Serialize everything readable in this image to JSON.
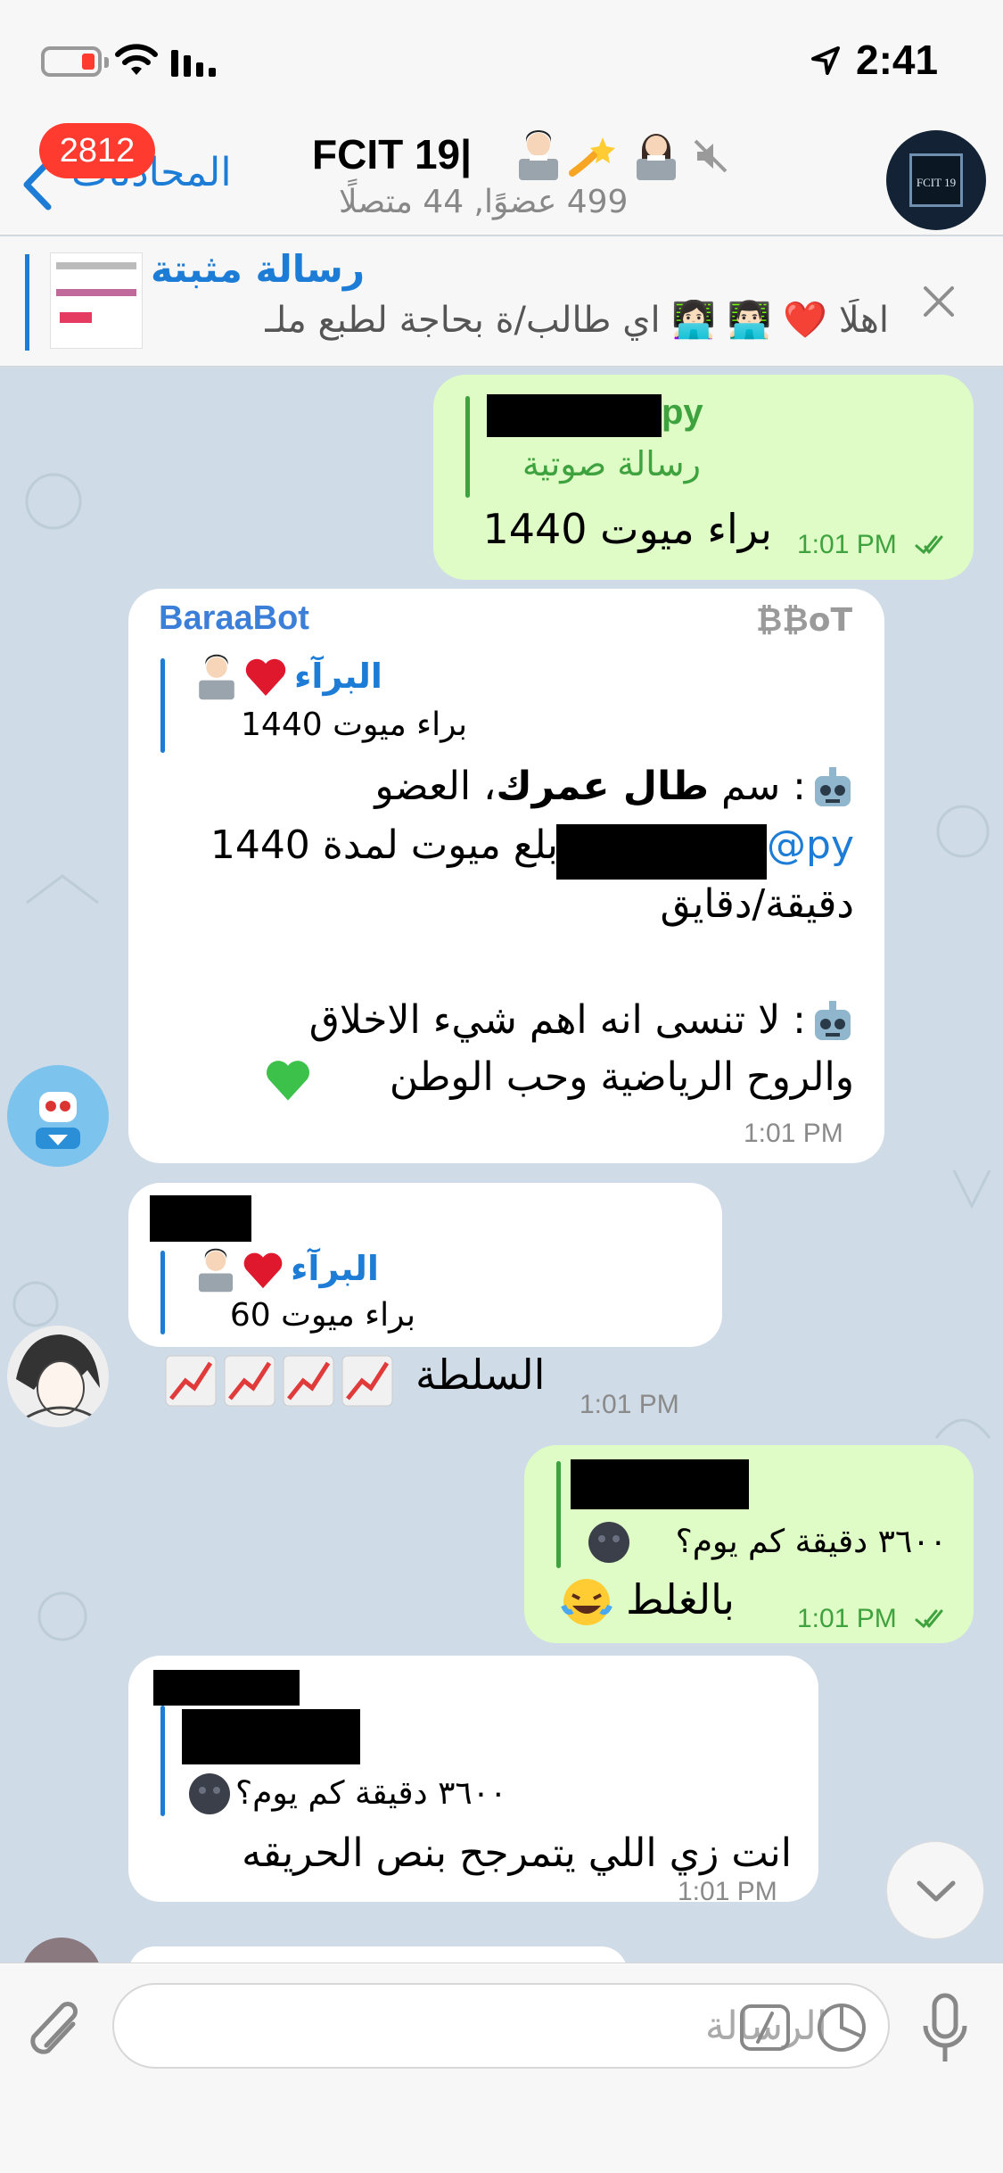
{
  "status_bar": {
    "time": "2:41"
  },
  "header": {
    "back_label": "المحادثات",
    "unread_badge": "2812",
    "title": "FCIT 19|",
    "subtitle": "499 عضوًا, 44 متصلًا"
  },
  "group_avatar": {
    "label": "FCIT 19"
  },
  "pinned": {
    "title": "رسالة مثبتة",
    "text": "اهلًا ❤️ 👨🏻‍💻 👩🏻‍💻 اي طالب/ة بحاجة لطبع ملـ"
  },
  "messages": [
    {
      "id": "m1",
      "direction": "out",
      "reply_name_suffix": "py",
      "reply_text": "رسالة صوتية",
      "text": "براء ميوت 1440",
      "time": "1:01 PM"
    },
    {
      "id": "m2",
      "direction": "in",
      "sender": "BaraaBot",
      "badge": "₿₿oT",
      "reply_name": "البرآء",
      "reply_text": "براء ميوت 1440",
      "line1_pre": ": سم ",
      "line1_bold": "طال عمرك",
      "line1_post": "، العضو",
      "line2_handle": "py@",
      "line2_rest": "بلع ميوت لمدة 1440",
      "line3": "دقيقة/دقايق",
      "line4": ": لا تنسى انه اهم شيء الاخلاق",
      "line5": "والروح الرياضية وحب الوطن",
      "time": "1:01 PM"
    },
    {
      "id": "m3",
      "direction": "in",
      "reply_name": "البرآء",
      "reply_text": "براء ميوت 60",
      "text": "السلطة",
      "time": "1:01 PM"
    },
    {
      "id": "m4",
      "direction": "out",
      "reply_text": "٣٦٠٠ دقيقة كم يوم؟",
      "text": "بالغلط",
      "time": "1:01 PM"
    },
    {
      "id": "m5",
      "direction": "in",
      "reply_text": "٣٦٠٠ دقيقة كم يوم؟",
      "text": "انت زي اللي يتمرجح بنص الحريقه",
      "time": "1:01 PM"
    }
  ],
  "input": {
    "placeholder": "الرسالة"
  },
  "colors": {
    "accent": "#1c7cd6",
    "outgoing_bubble": "#dffbc6",
    "outgoing_time": "#3ea33e",
    "chat_background": "#cfdbe6",
    "badge": "#ff3b30"
  }
}
